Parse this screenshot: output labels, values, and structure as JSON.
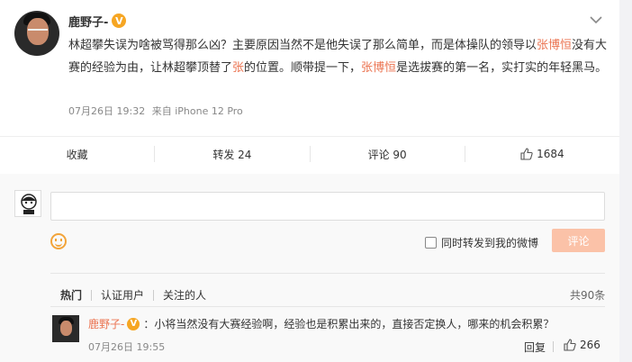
{
  "post": {
    "author": "鹿野子-",
    "verified_badge": "V",
    "text_parts": [
      "林超攀失误为啥被骂得那么凶？主要原因当然不是他失误了那么简单，而是体操队的领导以",
      "张博恒",
      "没有大赛的经验为由，让林超攀顶替了",
      "张",
      "的位置。顺带提一下，",
      "张博恒",
      "是选拔赛的第一名，实打实的年轻黑马。"
    ],
    "time": "07月26日 19:32",
    "source_prefix": "来自",
    "source": "iPhone 12 Pro"
  },
  "actions": {
    "favorite": "收藏",
    "repost": "转发 24",
    "comment": "评论 90",
    "like_count": "1684"
  },
  "composer": {
    "input_value": "",
    "repost_option_label": "同时转发到我的微博",
    "submit_label": "评论"
  },
  "filters": {
    "tabs": [
      "热门",
      "认证用户",
      "关注的人"
    ],
    "total": "共90条"
  },
  "comments": [
    {
      "user": "鹿野子-",
      "badge": "V",
      "text": "：小将当然没有大赛经验啊，经验也是积累出来的，直接否定换人，哪来的机会积累？",
      "time": "07月26日 19:55",
      "reply_label": "回复",
      "like_count": "266"
    }
  ],
  "colors": {
    "highlight": "#eb7350",
    "badge": "#f6a623",
    "submit_disabled": "#fbc2a8"
  },
  "icons": [
    "chevron-down-icon",
    "thumb-up-icon",
    "emoji-smile-icon",
    "verified-v-icon"
  ]
}
